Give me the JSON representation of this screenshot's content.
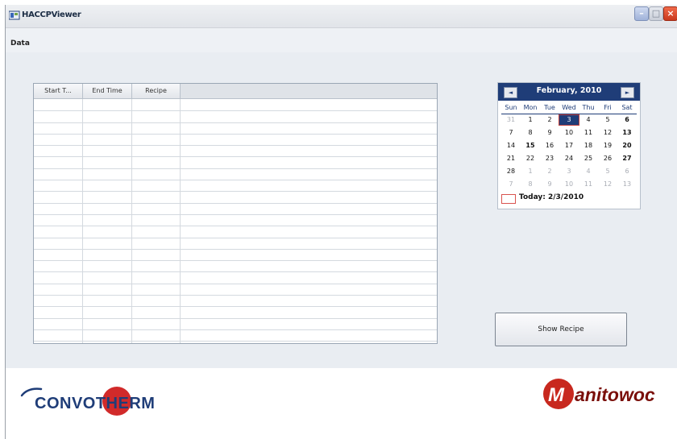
{
  "window": {
    "title": "HACCPViewer"
  },
  "menu": {
    "items": [
      "Data"
    ]
  },
  "grid": {
    "columns": [
      "Start T...",
      "End Time",
      "Recipe"
    ],
    "rows": []
  },
  "calendar": {
    "month_title": "February, 2010",
    "prev_label": "◄",
    "next_label": "►",
    "weekdays": [
      "Sun",
      "Mon",
      "Tue",
      "Wed",
      "Thu",
      "Fri",
      "Sat"
    ],
    "weeks": [
      [
        "31",
        "1",
        "2",
        "3",
        "4",
        "5",
        "6"
      ],
      [
        "7",
        "8",
        "9",
        "10",
        "11",
        "12",
        "13"
      ],
      [
        "14",
        "15",
        "16",
        "17",
        "18",
        "19",
        "20"
      ],
      [
        "21",
        "22",
        "23",
        "24",
        "25",
        "26",
        "27"
      ],
      [
        "28",
        "1",
        "2",
        "3",
        "4",
        "5",
        "6"
      ],
      [
        "7",
        "8",
        "9",
        "10",
        "11",
        "12",
        "13"
      ]
    ],
    "selected": "3",
    "today_label": "Today: 2/3/2010"
  },
  "actions": {
    "show_recipe": "Show Recipe"
  },
  "logos": {
    "left": "CONVOTHERM",
    "right": "anitowoc",
    "right_mark": "M"
  },
  "colors": {
    "calendar_header": "#1f3d78",
    "convotherm_text": "#1f3d78",
    "convotherm_accent": "#d12a2a",
    "manitowoc_red": "#c8281e",
    "manitowoc_text": "#7a0f0a"
  }
}
